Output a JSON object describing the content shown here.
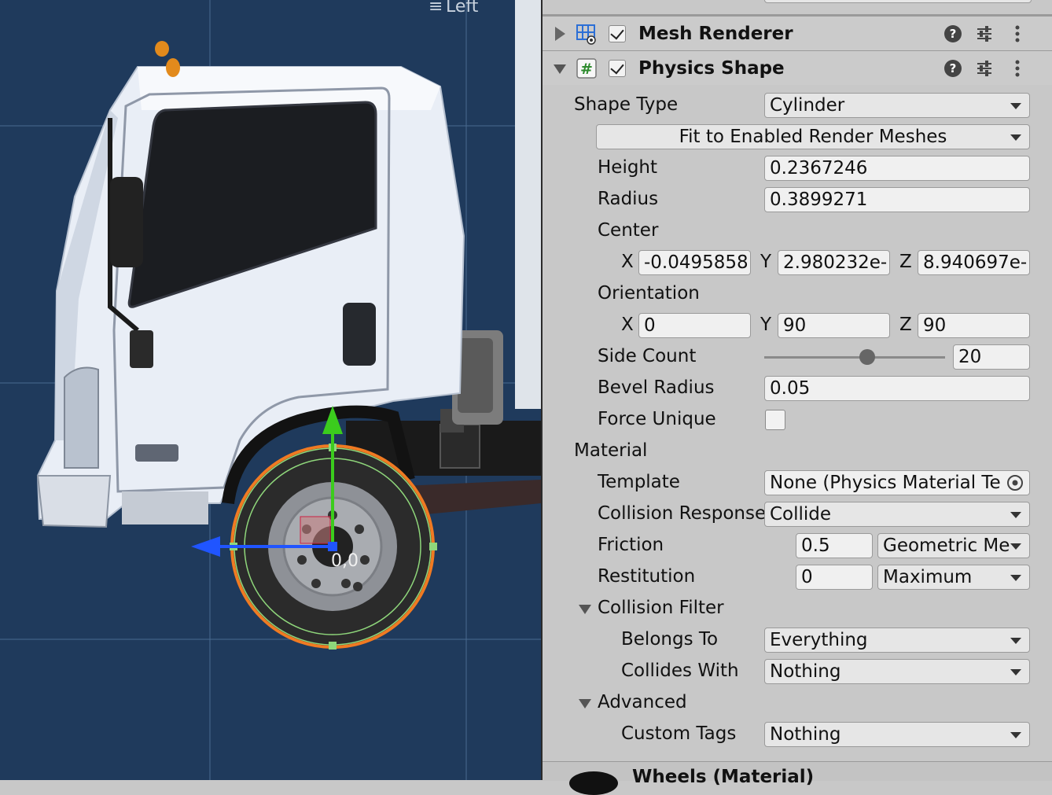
{
  "scene": {
    "view_label": "Left",
    "gizmo_label": "0,0",
    "colors": {
      "background": "#1f3a5c",
      "grid": "#4a6a8f",
      "collider": "#f07a22",
      "x_axis": "#2055ff",
      "y_axis": "#3bcc1d"
    }
  },
  "inspector": {
    "mesh_renderer": {
      "title": "Mesh Renderer",
      "enabled": true,
      "icons": [
        "mesh-renderer-icon",
        "help-icon",
        "preset-icon",
        "menu-icon"
      ]
    },
    "physics_shape": {
      "title": "Physics Shape",
      "enabled": true,
      "shape_type": {
        "label": "Shape Type",
        "value": "Cylinder"
      },
      "fit_button": "Fit to Enabled Render Meshes",
      "height": {
        "label": "Height",
        "value": "0.2367246"
      },
      "radius": {
        "label": "Radius",
        "value": "0.3899271"
      },
      "center": {
        "label": "Center",
        "x_label": "X",
        "x": "-0.0495858",
        "y_label": "Y",
        "y": "2.980232e-",
        "z_label": "Z",
        "z": "8.940697e-"
      },
      "orientation": {
        "label": "Orientation",
        "x_label": "X",
        "x": "0",
        "y_label": "Y",
        "y": "90",
        "z_label": "Z",
        "z": "90"
      },
      "side_count": {
        "label": "Side Count",
        "value": "20",
        "slider_fraction": 0.57
      },
      "bevel_radius": {
        "label": "Bevel Radius",
        "value": "0.05"
      },
      "force_unique": {
        "label": "Force Unique",
        "checked": false
      },
      "material_header": "Material",
      "template": {
        "label": "Template",
        "value": "None (Physics Material Te"
      },
      "collision_response": {
        "label": "Collision Response",
        "value": "Collide"
      },
      "friction": {
        "label": "Friction",
        "value": "0.5",
        "mode": "Geometric Me"
      },
      "restitution": {
        "label": "Restitution",
        "value": "0",
        "mode": "Maximum"
      },
      "collision_filter": {
        "label": "Collision Filter",
        "belongs_to_label": "Belongs To",
        "belongs_to": "Everything",
        "collides_with_label": "Collides With",
        "collides_with": "Nothing"
      },
      "advanced": {
        "label": "Advanced",
        "custom_tags_label": "Custom Tags",
        "custom_tags": "Nothing"
      }
    },
    "next_component": {
      "title": "Wheels (Material)"
    }
  }
}
